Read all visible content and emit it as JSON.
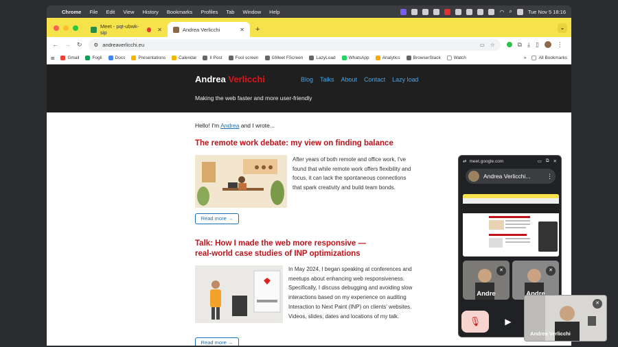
{
  "menubar": {
    "apple": "",
    "app": "Chrome",
    "items": [
      "File",
      "Edit",
      "View",
      "History",
      "Bookmarks",
      "Profiles",
      "Tab",
      "Window",
      "Help"
    ],
    "datetime": "Tue Nov 5  18:16"
  },
  "tabs": [
    {
      "title": "Meet - pqt-ubwk-sip"
    },
    {
      "title": "Andrea Verlicchi"
    }
  ],
  "newtab": "+",
  "address": {
    "url": "andreaverlicchi.eu"
  },
  "bookmarks": [
    "Gmail",
    "Fogli",
    "Docs",
    "Presentations",
    "Calendar",
    "Il Post",
    "Fool screen",
    "GMeet FScreen",
    "LazyLoad",
    "WhatsApp",
    "Analytics",
    "BrowserStack",
    "Watch"
  ],
  "bookmarks_more": "»",
  "all_bookmarks": "All Bookmarks",
  "site": {
    "logo_first": "Andrea ",
    "logo_last": "Verlicchi",
    "nav": [
      "Blog",
      "Talks",
      "About",
      "Contact",
      "Lazy load"
    ],
    "tagline": "Making the web faster and more user-friendly",
    "hello_pre": "Hello! I'm ",
    "hello_link": "Andrea",
    "hello_post": " and I wrote...",
    "posts": [
      {
        "title": "The remote work debate: my view on finding balance",
        "excerpt": "After years of both remote and office work, I've found that while remote work offers flexibility and focus, it can lack the spontaneous connections that spark creativity and build team bonds.",
        "read_more": "Read more →"
      },
      {
        "title": "Talk: How I made the web more responsive — real-world case studies of INP optimizations",
        "excerpt": "In May 2024, I began speaking at conferences and meetups about enhancing web responsiveness. Specifically, I discuss debugging and avoiding slow interactions based on my experience on auditing Interaction to Next Paint (INP) on clients' websites. Videos, slides, dates and locations of my talk.",
        "read_more": "Read more →"
      }
    ]
  },
  "meet": {
    "domain": "meet.google.com",
    "presenter": "Andrea Verlicchi...",
    "tile1_label": "Andre",
    "tile2_label": "Andre",
    "self_label": "Andrea Verlicchi"
  },
  "colors": {
    "accent_red": "#c1121a",
    "tab_yellow": "#f6e24a",
    "link_blue": "#1a6fb5",
    "header_dark": "#1f1f1f"
  }
}
